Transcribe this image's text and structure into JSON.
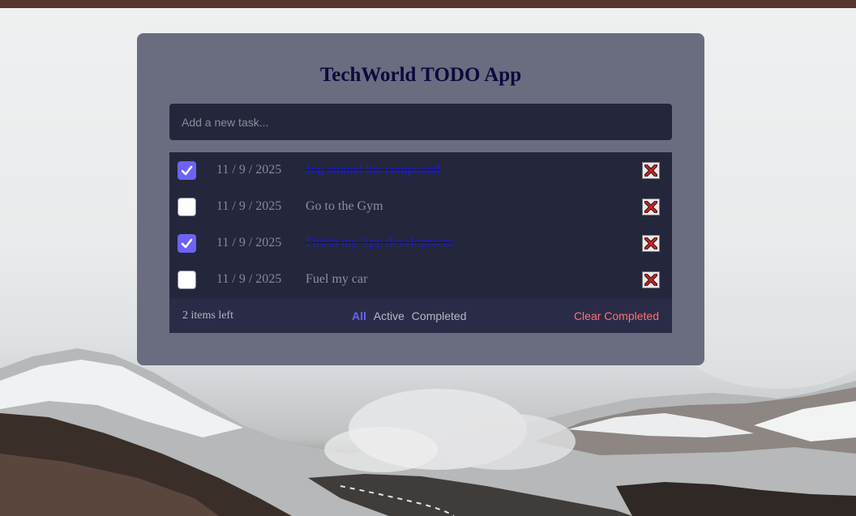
{
  "app": {
    "title": "TechWorld TODO App"
  },
  "new_task": {
    "placeholder": "Add a new task..."
  },
  "todos": [
    {
      "date": "11 / 9 / 2025",
      "text": "Jog around the compound",
      "completed": true
    },
    {
      "date": "11 / 9 / 2025",
      "text": "Go to the Gym",
      "completed": false
    },
    {
      "date": "11 / 9 / 2025",
      "text": "Finish my App development",
      "completed": true
    },
    {
      "date": "11 / 9 / 2025",
      "text": "Fuel my car",
      "completed": false
    }
  ],
  "footer": {
    "items_left": "2 items left",
    "filters": [
      "All",
      "Active",
      "Completed"
    ],
    "active_filter": "All",
    "clear_label": "Clear Completed"
  },
  "icons": {
    "checkbox_checked": "check-icon",
    "delete": "close-x-icon"
  },
  "colors": {
    "topbar": "#553631",
    "card": "#6a6c80",
    "panel": "#24263b",
    "accent": "#6b63f4",
    "completed_text": "#1818f0",
    "clear": "#ff6f73",
    "delete_x": "#cc2222"
  }
}
